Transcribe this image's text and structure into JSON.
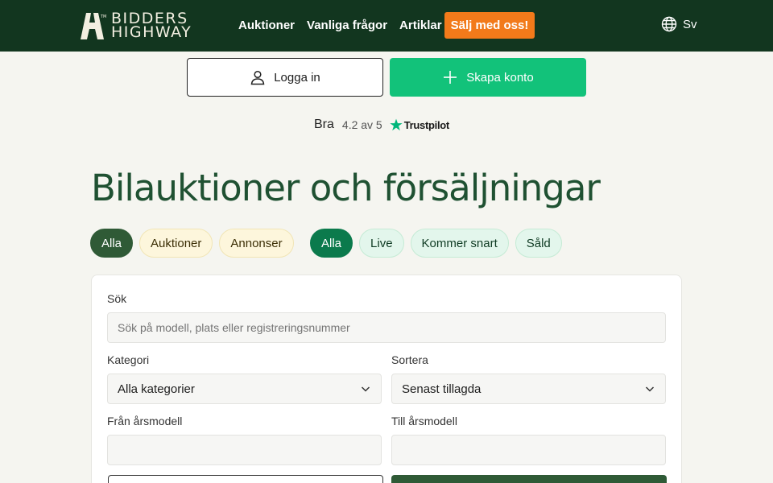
{
  "brand": {
    "line1": "BIDDERS",
    "line2": "HIGHWAY"
  },
  "nav": {
    "items": [
      "Auktioner",
      "Vanliga frågor",
      "Artiklar"
    ],
    "sell_label": "Sälj med oss!"
  },
  "language": {
    "label": "Sv"
  },
  "auth": {
    "login_label": "Logga in",
    "create_label": "Skapa konto"
  },
  "trustpilot": {
    "rating_word": "Bra",
    "score_text": "4.2 av 5",
    "brand": "Trustpilot"
  },
  "page": {
    "title": "Bilauktioner och försäljningar"
  },
  "type_filters": [
    "Alla",
    "Auktioner",
    "Annonser"
  ],
  "status_filters": [
    "Alla",
    "Live",
    "Kommer snart",
    "Såld"
  ],
  "form": {
    "search_label": "Sök",
    "search_placeholder": "Sök på modell, plats eller registreringsnummer",
    "category_label": "Kategori",
    "category_value": "Alla kategorier",
    "sort_label": "Sortera",
    "sort_value": "Senast tillagda",
    "from_year_label": "Från årsmodell",
    "to_year_label": "Till årsmodell"
  },
  "colors": {
    "header": "#12361f",
    "accent_orange": "#f27a1a",
    "accent_green": "#12c27a",
    "title_green": "#1f5132"
  }
}
